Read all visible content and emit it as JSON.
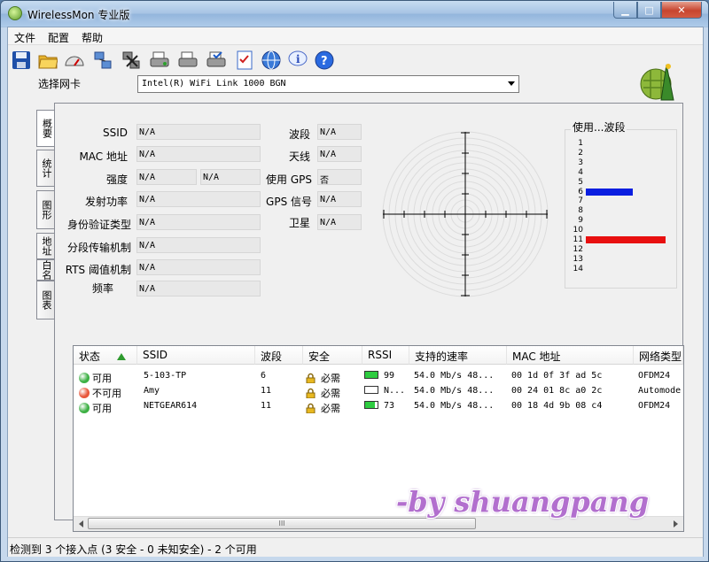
{
  "window": {
    "title": "WirelessMon 专业版",
    "minimize": "▁",
    "maximize": "□",
    "close": "✕"
  },
  "menu": [
    "文件",
    "配置",
    "帮助"
  ],
  "toolbar": [
    {
      "icon": "save-icon"
    },
    {
      "icon": "open-folder-icon"
    },
    {
      "icon": "speedometer-icon"
    },
    {
      "icon": "network-icon"
    },
    {
      "icon": "disconnect-icon"
    },
    {
      "icon": "print-icon"
    },
    {
      "icon": "print-preview-icon"
    },
    {
      "icon": "print-setup-icon"
    },
    {
      "icon": "checklist-icon"
    },
    {
      "icon": "globe-icon"
    },
    {
      "icon": "info-icon"
    },
    {
      "icon": "help-icon"
    }
  ],
  "adapter": {
    "label": "选择网卡",
    "selected": "Intel(R) WiFi Link 1000 BGN"
  },
  "tabs": [
    "概要",
    "统计",
    "图形",
    "地址",
    "白名",
    "图表"
  ],
  "summary": {
    "ssid": {
      "label": "SSID",
      "value": "N/A"
    },
    "mac": {
      "label": "MAC 地址",
      "value": "N/A"
    },
    "strength": {
      "label": "强度",
      "value": "N/A",
      "value2": "N/A"
    },
    "tx_power": {
      "label": "发射功率",
      "value": "N/A"
    },
    "auth": {
      "label": "身份验证类型",
      "value": "N/A"
    },
    "frag": {
      "label": "分段传输机制",
      "value": "N/A"
    },
    "rts": {
      "label": "RTS 阈值机制",
      "value": "N/A"
    },
    "freq": {
      "label": "频率",
      "value": "N/A"
    },
    "channel": {
      "label": "波段",
      "value": "N/A"
    },
    "antenna": {
      "label": "天线",
      "value": "N/A"
    },
    "use_gps": {
      "label": "使用 GPS",
      "value": "否"
    },
    "gps_signal": {
      "label": "GPS 信号",
      "value": "N/A"
    },
    "satellite": {
      "label": "卫星",
      "value": "N/A"
    }
  },
  "channel_usage": {
    "title": "使用...波段",
    "channels": [
      "1",
      "2",
      "3",
      "4",
      "5",
      "6",
      "7",
      "8",
      "9",
      "10",
      "11",
      "12",
      "13",
      "14"
    ],
    "bars": [
      {
        "channel": "6",
        "level": 0.52,
        "color": "#0a1ee0"
      },
      {
        "channel": "11",
        "level": 0.88,
        "color": "#e81010"
      }
    ]
  },
  "table": {
    "columns": [
      "状态",
      "SSID",
      "波段",
      "安全",
      "RSSI",
      "支持的速率",
      "MAC 地址",
      "网络类型"
    ],
    "rows": [
      {
        "status": "可用",
        "status_color": "#3cb043",
        "ssid": "5-103-TP",
        "channel": "6",
        "security": "必需",
        "rssi": "99",
        "rssi_level": 1.0,
        "rates": "54.0 Mb/s  48...",
        "mac": "00 1d 0f 3f ad 5c",
        "type": "OFDM24"
      },
      {
        "status": "不可用",
        "status_color": "#e8563a",
        "ssid": "Amy",
        "channel": "11",
        "security": "必需",
        "rssi": "N...",
        "rssi_level": 0.0,
        "rates": "54.0 Mb/s  48...",
        "mac": "00 24 01 8c a0 2c",
        "type": "Automode"
      },
      {
        "status": "可用",
        "status_color": "#3cb043",
        "ssid": "NETGEAR614",
        "channel": "11",
        "security": "必需",
        "rssi": "73",
        "rssi_level": 0.8,
        "rates": "54.0 Mb/s  48...",
        "mac": "00 18 4d 9b 08 c4",
        "type": "OFDM24"
      }
    ],
    "scroll_grip": "III"
  },
  "status_bar": "检测到 3 个接入点 (3 安全 - 0 未知安全) - 2 个可用",
  "watermark": "-by shuangpang"
}
